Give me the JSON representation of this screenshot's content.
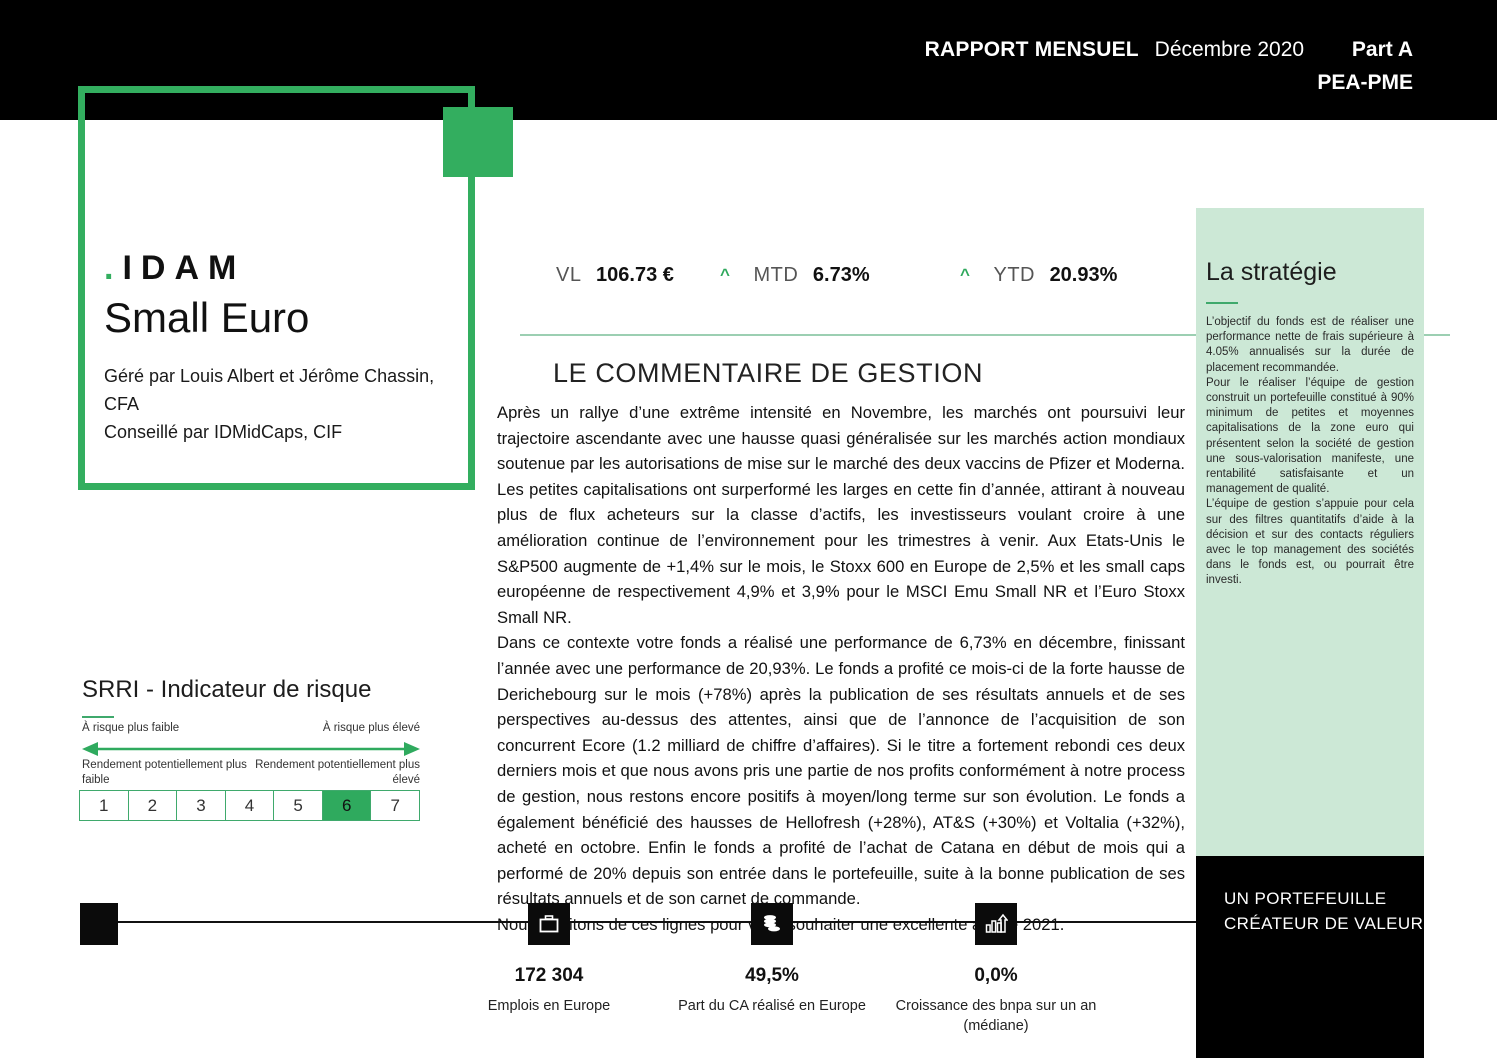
{
  "header": {
    "report_label": "RAPPORT MENSUEL",
    "date": "Décembre 2020",
    "part": "Part A",
    "share_class": "PEA-PME"
  },
  "identity": {
    "brand_dot": ".",
    "brand": "IDAM",
    "fund_name": "Small Euro",
    "managers": "Géré par Louis Albert et Jérôme Chassin, CFA",
    "advisor": "Conseillé par IDMidCaps, CIF"
  },
  "kpis": [
    {
      "label": "VL",
      "value": "106.73 €",
      "trend": "",
      "trend_icon": ""
    },
    {
      "label": "MTD",
      "value": "6.73%",
      "trend": "up",
      "trend_icon": "chevron-up-icon"
    },
    {
      "label": "YTD",
      "value": "20.93%",
      "trend": "up",
      "trend_icon": "chevron-up-icon"
    }
  ],
  "commentary": {
    "title": "LE COMMENTAIRE DE GESTION",
    "paragraphs": [
      "Après un rallye d’une extrême intensité en Novembre, les marchés ont poursuivi leur trajectoire ascendante avec une hausse quasi généralisée sur les marchés action mondiaux soutenue par les autorisations de mise sur le marché des deux vaccins de Pfizer et Moderna. Les petites capitalisations ont surperformé les larges en cette fin d’année, attirant à nouveau plus de flux acheteurs sur la classe d’actifs, les investisseurs voulant croire à une amélioration continue de l’environnement pour les trimestres à venir. Aux Etats-Unis le S&P500 augmente de +1,4% sur le mois, le Stoxx 600 en Europe de 2,5% et les small caps européenne de respectivement 4,9% et 3,9% pour le MSCI Emu Small NR et l’Euro Stoxx Small NR.",
      "Dans ce contexte votre fonds a réalisé une performance de 6,73% en décembre, finissant l’année avec une performance de 20,93%. Le fonds a profité ce mois-ci de la forte hausse de Derichebourg sur le mois (+78%) après la publication de ses résultats annuels et de ses perspectives au-dessus des attentes, ainsi que de l’annonce de l’acquisition de son concurrent Ecore (1.2 milliard de chiffre d’affaires). Si le titre a fortement rebondi ces deux derniers mois et que nous avons pris une partie de nos profits conformément à notre process de gestion, nous restons encore positifs à moyen/long terme sur son évolution. Le fonds a également bénéficié des hausses de Hellofresh (+28%), AT&S (+30%) et Voltalia (+32%), acheté en octobre. Enfin le fonds a profité de l’achat de Catana en début de mois qui a performé de 20% depuis son entrée dans le portefeuille, suite à la bonne publication de ses résultats annuels et de son carnet de commande.",
      "Nous profitons de ces lignes pour vous souhaiter une excellente année 2021."
    ]
  },
  "strategy": {
    "title": "La stratégie",
    "paragraphs": [
      "L’objectif du fonds est de réaliser une performance nette de frais supérieure à 4.05% annualisés sur la durée de placement recommandée.",
      "Pour le réaliser l’équipe de gestion construit un portefeuille constitué à 90% minimum de petites et moyennes capitalisations de la zone euro qui présentent selon la société de gestion une sous-valorisation manifeste, une rentabilité satisfaisante et un management de qualité.",
      "L’équipe de gestion s’appuie pour cela sur des filtres quantitatifs d’aide à la décision et sur des contacts réguliers avec le top management des sociétés dans le fonds est, ou pourrait être investi."
    ]
  },
  "tagline": "UN PORTEFEUILLE CRÉATEUR DE VALEUR",
  "srri": {
    "title": "SRRI - Indicateur de risque",
    "label_low": "À risque plus faible",
    "label_high": "À risque plus élevé",
    "sub_low": "Rendement potentiellement plus faible",
    "sub_high": "Rendement potentiellement plus élevé",
    "scale": [
      "1",
      "2",
      "3",
      "4",
      "5",
      "6",
      "7"
    ],
    "active": "6"
  },
  "stats": [
    {
      "icon": "briefcase-icon",
      "value": "172 304",
      "caption": "Emplois en Europe"
    },
    {
      "icon": "coins-icon",
      "value": "49,5%",
      "caption": "Part du CA réalisé en Europe"
    },
    {
      "icon": "bar-chart-up-icon",
      "value": "0,0%",
      "caption": "Croissance des bnpa sur un an (médiane)"
    }
  ],
  "colors": {
    "brand_green": "#33AE5F",
    "mint_panel": "#CCE8D6",
    "rule_green": "#9CCFB2",
    "black": "#000000"
  }
}
